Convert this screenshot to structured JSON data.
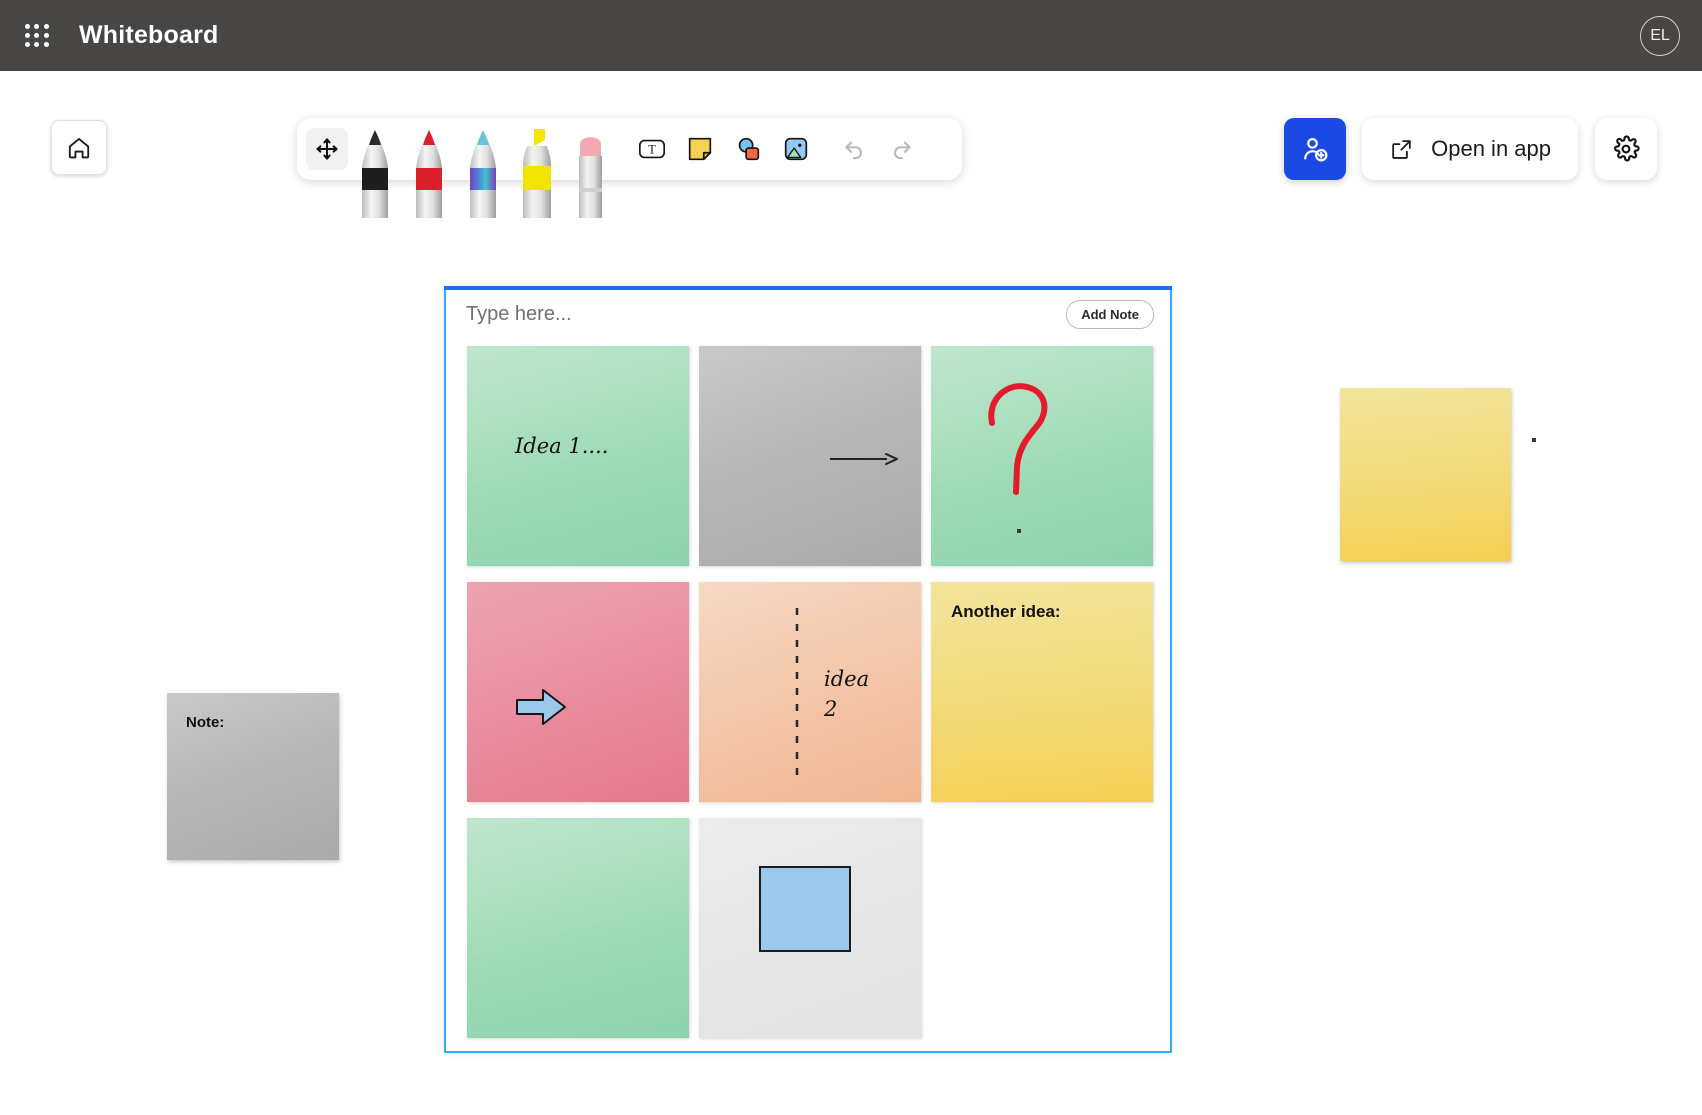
{
  "header": {
    "title": "Whiteboard",
    "waffle_icon": "grid-apps-icon",
    "avatar_initials": "EL"
  },
  "controls": {
    "home_icon": "home-icon",
    "share_icon": "person-add-icon",
    "open_in_app_label": "Open in app",
    "open_in_app_icon": "external-link-icon",
    "settings_icon": "gear-icon"
  },
  "toolbar": {
    "tools": [
      {
        "name": "move-tool",
        "icon": "move-arrows-icon",
        "selected": true
      },
      {
        "name": "black-pen",
        "icon": "pen-icon",
        "color": "#1a1a1a"
      },
      {
        "name": "red-pen",
        "icon": "pen-icon",
        "color": "#e0202a"
      },
      {
        "name": "rainbow-pen",
        "icon": "pen-icon",
        "color": "#7a4fd0"
      },
      {
        "name": "yellow-highlighter",
        "icon": "highlighter-icon",
        "color": "#f5e800"
      },
      {
        "name": "eraser",
        "icon": "eraser-icon",
        "color": "#f4a6ad"
      },
      {
        "name": "text-tool",
        "icon": "text-box-icon",
        "label": "T"
      },
      {
        "name": "sticky-note-tool",
        "icon": "sticky-note-icon",
        "color": "#f6d34d"
      },
      {
        "name": "shapes-tool",
        "icon": "shapes-icon",
        "color": "#6ec0f2"
      },
      {
        "name": "image-tool",
        "icon": "image-icon",
        "color": "#8ec6f5"
      },
      {
        "name": "undo",
        "icon": "undo-arrow-icon",
        "disabled": true
      },
      {
        "name": "redo",
        "icon": "redo-arrow-icon",
        "disabled": true
      }
    ]
  },
  "panel": {
    "input_placeholder": "Type here...",
    "input_value": "",
    "add_note_label": "Add Note",
    "notes": [
      {
        "id": "note-1",
        "color": "green",
        "text": "Idea 1....",
        "style": "hand",
        "ink": null
      },
      {
        "id": "note-2",
        "color": "grey",
        "text": "",
        "style": null,
        "ink": null
      },
      {
        "id": "note-3",
        "color": "green",
        "text": "",
        "style": null,
        "ink": "red-question-mark"
      },
      {
        "id": "note-4",
        "color": "pink",
        "text": "",
        "style": null,
        "ink": "blue-block-arrow"
      },
      {
        "id": "note-5",
        "color": "peach",
        "text": "idea\n2",
        "style": "hand",
        "ink": "dashed-vertical-line"
      },
      {
        "id": "note-6",
        "color": "yellow",
        "text": "Another idea:",
        "style": "bold",
        "ink": null
      },
      {
        "id": "note-7",
        "color": "green",
        "text": "",
        "style": null,
        "ink": null
      },
      {
        "id": "note-8",
        "color": "white",
        "text": "",
        "style": null,
        "ink": "blue-square"
      }
    ],
    "connector_arrow": "black-arrow-right"
  },
  "canvas": {
    "free_notes": [
      {
        "id": "free-note-grey",
        "color": "grey",
        "text": "Note:",
        "style": "bold"
      },
      {
        "id": "free-note-yellow",
        "color": "yellow",
        "text": "",
        "style": null
      }
    ],
    "ink_dots": 2
  },
  "colors": {
    "header_bg": "#484644",
    "accent_blue": "#1b49e5",
    "selection_blue": "#2dadfb",
    "selection_top": "#1e6ef5",
    "red_ink": "#e01b2d",
    "blue_shape": "#9bc9ec"
  }
}
